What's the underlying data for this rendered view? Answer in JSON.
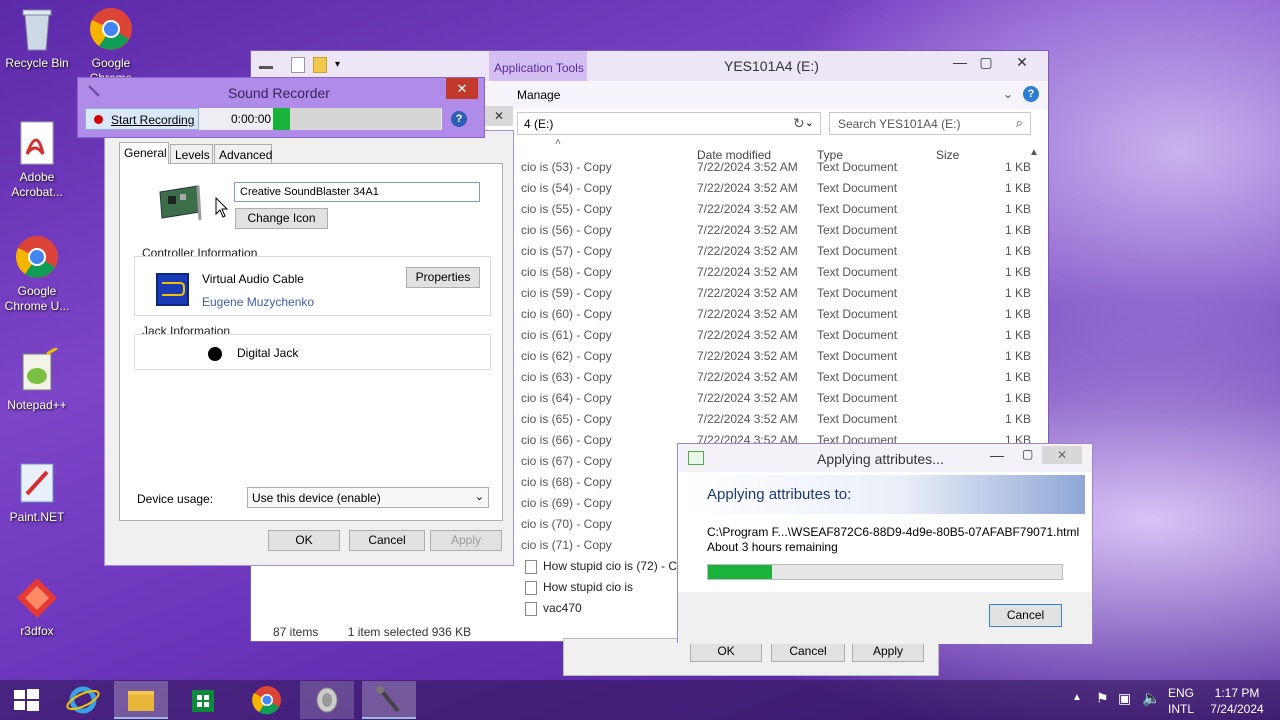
{
  "desktop": {
    "icons": [
      {
        "label": "Recycle Bin"
      },
      {
        "label": "Google Chrome"
      },
      {
        "label": "Adobe Acrobat..."
      },
      {
        "label": "Google Chrome U..."
      },
      {
        "label": "Notepad++"
      },
      {
        "label": "Paint.NET"
      },
      {
        "label": "r3dfox"
      }
    ]
  },
  "explorer": {
    "title": "YES101A4 (E:)",
    "context_tab": "Application Tools",
    "ribbon_tab": "Manage",
    "address": "4 (E:)",
    "search_placeholder": "Search YES101A4 (E:)",
    "columns": {
      "date": "Date modified",
      "type": "Type",
      "size": "Size"
    },
    "rows": [
      {
        "name": "cio is (53) - Copy",
        "date": "7/22/2024 3:52 AM",
        "type": "Text Document",
        "size": "1 KB"
      },
      {
        "name": "cio is (54) - Copy",
        "date": "7/22/2024 3:52 AM",
        "type": "Text Document",
        "size": "1 KB"
      },
      {
        "name": "cio is (55) - Copy",
        "date": "7/22/2024 3:52 AM",
        "type": "Text Document",
        "size": "1 KB"
      },
      {
        "name": "cio is (56) - Copy",
        "date": "7/22/2024 3:52 AM",
        "type": "Text Document",
        "size": "1 KB"
      },
      {
        "name": "cio is (57) - Copy",
        "date": "7/22/2024 3:52 AM",
        "type": "Text Document",
        "size": "1 KB"
      },
      {
        "name": "cio is (58) - Copy",
        "date": "7/22/2024 3:52 AM",
        "type": "Text Document",
        "size": "1 KB"
      },
      {
        "name": "cio is (59) - Copy",
        "date": "7/22/2024 3:52 AM",
        "type": "Text Document",
        "size": "1 KB"
      },
      {
        "name": "cio is (60) - Copy",
        "date": "7/22/2024 3:52 AM",
        "type": "Text Document",
        "size": "1 KB"
      },
      {
        "name": "cio is (61) - Copy",
        "date": "7/22/2024 3:52 AM",
        "type": "Text Document",
        "size": "1 KB"
      },
      {
        "name": "cio is (62) - Copy",
        "date": "7/22/2024 3:52 AM",
        "type": "Text Document",
        "size": "1 KB"
      },
      {
        "name": "cio is (63) - Copy",
        "date": "7/22/2024 3:52 AM",
        "type": "Text Document",
        "size": "1 KB"
      },
      {
        "name": "cio is (64) - Copy",
        "date": "7/22/2024 3:52 AM",
        "type": "Text Document",
        "size": "1 KB"
      },
      {
        "name": "cio is (65) - Copy",
        "date": "7/22/2024 3:52 AM",
        "type": "Text Document",
        "size": "1 KB"
      },
      {
        "name": "cio is (66) - Copy",
        "date": "7/22/2024 3:52 AM",
        "type": "Text Document",
        "size": "1 KB"
      },
      {
        "name": "cio is (67) - Copy",
        "date": "",
        "type": "",
        "size": ""
      },
      {
        "name": "cio is (68) - Copy",
        "date": "",
        "type": "",
        "size": ""
      },
      {
        "name": "cio is (69) - Copy",
        "date": "",
        "type": "",
        "size": ""
      },
      {
        "name": "cio is (70) - Copy",
        "date": "",
        "type": "",
        "size": ""
      },
      {
        "name": "cio is (71) - Copy",
        "date": "",
        "type": "",
        "size": ""
      },
      {
        "name": "How stupid cio is (72) - Copy",
        "date": "",
        "type": "",
        "size": ""
      },
      {
        "name": "How stupid cio is",
        "date": "",
        "type": "",
        "size": ""
      },
      {
        "name": "vac470",
        "date": "",
        "type": "",
        "size": ""
      }
    ],
    "status": {
      "items": "87 items",
      "selected": "1 item selected  936 KB"
    }
  },
  "properties": {
    "tabs": [
      "General",
      "Levels",
      "Advanced"
    ],
    "device_name": "Creative SoundBlaster 34A1",
    "change_icon": "Change Icon",
    "controller_label": "Controller Information",
    "controller_name": "Virtual Audio Cable",
    "controller_vendor": "Eugene Muzychenko",
    "properties_btn": "Properties",
    "jack_label": "Jack Information",
    "jack_name": "Digital Jack",
    "usage_label": "Device usage:",
    "usage_value": "Use this device (enable)",
    "ok": "OK",
    "cancel": "Cancel",
    "apply": "Apply"
  },
  "sound_recorder": {
    "title": "Sound Recorder",
    "start": "Start Recording",
    "time": "0:00:00",
    "level": 0.1
  },
  "apply_dialog": {
    "title": "Applying attributes...",
    "heading": "Applying attributes to:",
    "path": "C:\\Program F...\\WSEAF872C6-88D9-4d9e-80B5-07AFABF79071.html",
    "remaining": "About 3 hours remaining",
    "progress": 0.18,
    "cancel": "Cancel"
  },
  "behind_buttons": {
    "ok": "OK",
    "cancel": "Cancel",
    "apply": "Apply"
  },
  "taskbar": {
    "lang": "ENG",
    "layout": "INTL",
    "time": "1:17 PM",
    "date": "7/24/2024"
  },
  "colors": {
    "accent": "#b18be8",
    "progress": "#19b33c"
  }
}
